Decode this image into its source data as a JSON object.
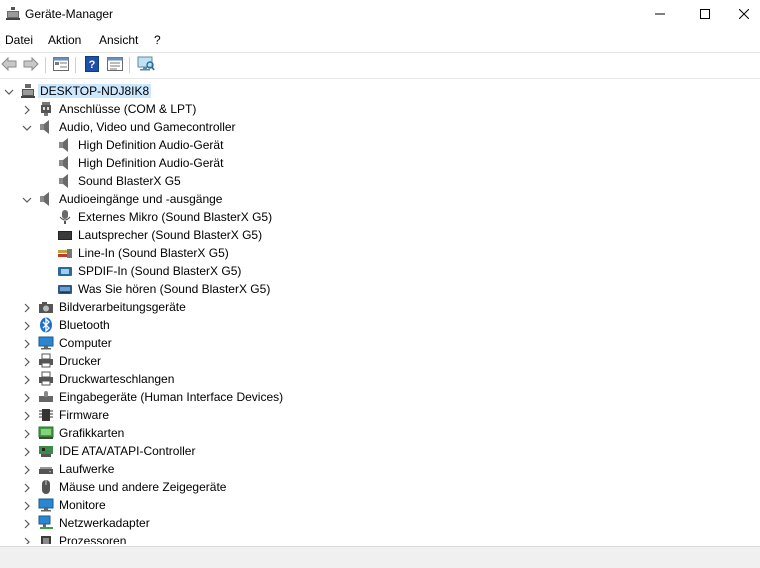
{
  "window": {
    "title": "Geräte-Manager",
    "controls": [
      "minimize-icon",
      "maximize-icon",
      "close-icon"
    ]
  },
  "menu": {
    "items": [
      "Datei",
      "Aktion",
      "Ansicht",
      "?"
    ]
  },
  "toolbar": {
    "buttons": [
      "back-arrow-icon",
      "forward-arrow-icon",
      "properties-icon",
      "help-icon",
      "device-view-icon",
      "scan-hardware-icon"
    ]
  },
  "tree": {
    "root": "DESKTOP-NDJ8IK8",
    "categories": {
      "ports": "Anschlüsse (COM & LPT)",
      "audio_video": {
        "label": "Audio, Video und Gamecontroller",
        "children": [
          "High Definition Audio-Gerät",
          "High Definition Audio-Gerät",
          "Sound BlasterX G5"
        ]
      },
      "audio_io": {
        "label": "Audioeingänge und -ausgänge",
        "children": [
          "Externes Mikro (Sound BlasterX G5)",
          "Lautsprecher (Sound BlasterX G5)",
          "Line-In (Sound BlasterX G5)",
          "SPDIF-In (Sound BlasterX G5)",
          "Was Sie hören (Sound BlasterX G5)"
        ]
      },
      "imaging": "Bildverarbeitungsgeräte",
      "bluetooth": "Bluetooth",
      "computer": "Computer",
      "printers": "Drucker",
      "print_queues": "Druckwarteschlangen",
      "hid": "Eingabegeräte (Human Interface Devices)",
      "firmware": "Firmware",
      "graphics": "Grafikkarten",
      "ide": "IDE ATA/ATAPI-Controller",
      "drives": "Laufwerke",
      "mice": "Mäuse und andere Zeigegeräte",
      "monitors": "Monitore",
      "network": "Netzwerkadapter",
      "processors": "Prozessoren"
    }
  },
  "colors": {
    "selection": "#cce8ff",
    "chevron": "#5a5a5a",
    "statusbar": "#f0f0f0"
  }
}
